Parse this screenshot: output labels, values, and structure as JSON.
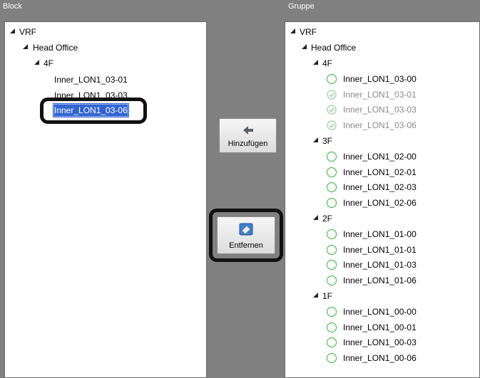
{
  "left_panel": {
    "header": "Block",
    "tree": {
      "root": "VRF",
      "site": "Head Office",
      "floor": "4F",
      "items": [
        "Inner_LON1_03-01",
        "Inner_LON1_03-03",
        "Inner_LON1_03-06"
      ],
      "selected_index": 2
    }
  },
  "buttons": {
    "add_label": "Hinzufügen",
    "remove_label": "Entfernen"
  },
  "right_panel": {
    "header": "Gruppe",
    "tree": {
      "root": "VRF",
      "site": "Head Office",
      "floors": [
        {
          "name": "4F",
          "units": [
            {
              "label": "Inner_LON1_03-00",
              "state": "unchecked"
            },
            {
              "label": "Inner_LON1_03-01",
              "state": "checked-grey"
            },
            {
              "label": "Inner_LON1_03-03",
              "state": "checked-grey"
            },
            {
              "label": "Inner_LON1_03-06",
              "state": "checked-grey"
            }
          ]
        },
        {
          "name": "3F",
          "units": [
            {
              "label": "Inner_LON1_02-00",
              "state": "unchecked"
            },
            {
              "label": "Inner_LON1_02-01",
              "state": "unchecked"
            },
            {
              "label": "Inner_LON1_02-03",
              "state": "unchecked"
            },
            {
              "label": "Inner_LON1_02-06",
              "state": "unchecked"
            }
          ]
        },
        {
          "name": "2F",
          "units": [
            {
              "label": "Inner_LON1_01-00",
              "state": "unchecked"
            },
            {
              "label": "Inner_LON1_01-01",
              "state": "unchecked"
            },
            {
              "label": "Inner_LON1_01-03",
              "state": "unchecked"
            },
            {
              "label": "Inner_LON1_01-06",
              "state": "unchecked"
            }
          ]
        },
        {
          "name": "1F",
          "units": [
            {
              "label": "Inner_LON1_00-00",
              "state": "unchecked"
            },
            {
              "label": "Inner_LON1_00-01",
              "state": "unchecked"
            },
            {
              "label": "Inner_LON1_00-03",
              "state": "unchecked"
            },
            {
              "label": "Inner_LON1_00-06",
              "state": "unchecked"
            }
          ]
        }
      ]
    }
  },
  "colors": {
    "background": "#808080",
    "selection": "#3265d0",
    "radio_green": "#3cb043",
    "highlight": "#111111"
  }
}
